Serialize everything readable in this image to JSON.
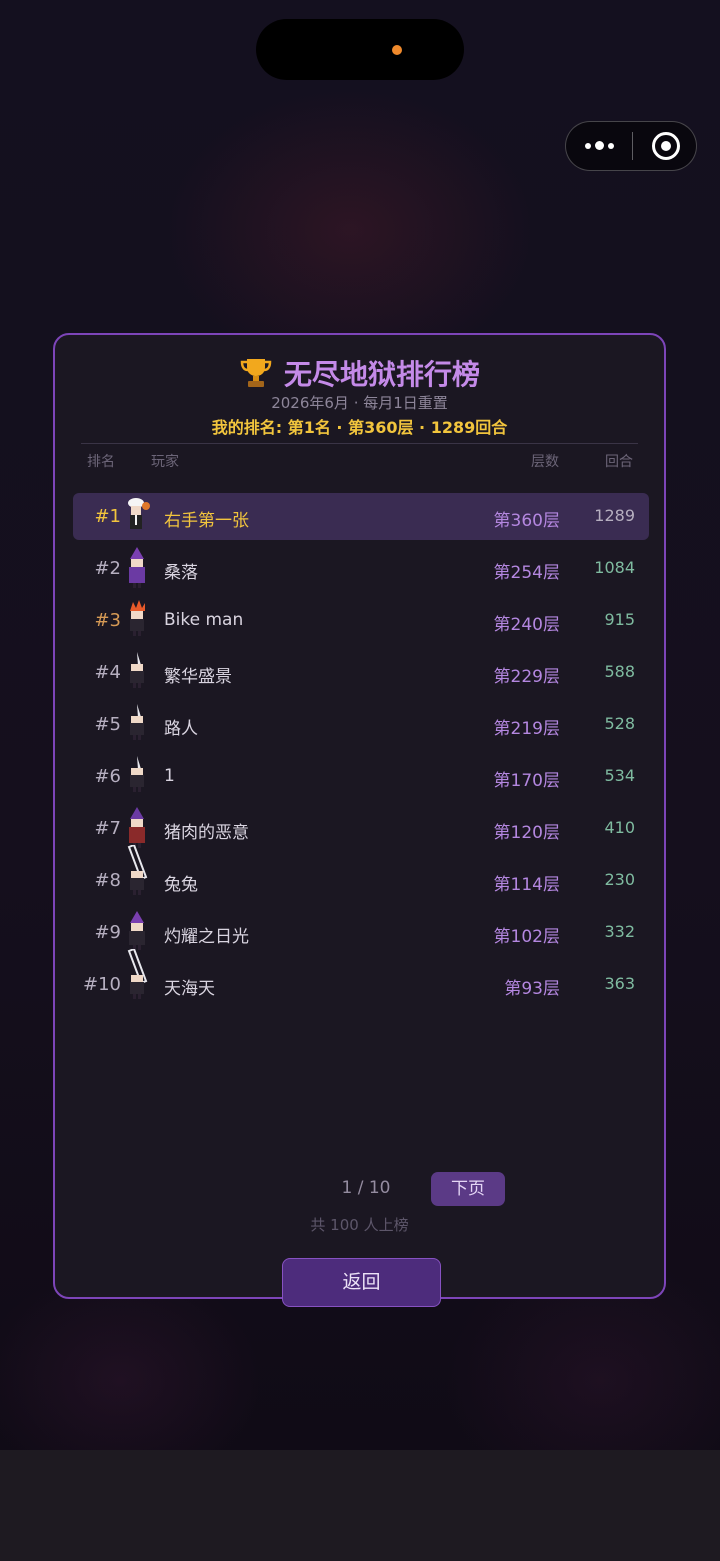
{
  "leaderboard": {
    "title": "无尽地狱排行榜",
    "subtitle": "2026年6月 · 每月1日重置",
    "my_rank": "我的排名: 第1名 · 第360层 · 1289回合",
    "headers": {
      "rank": "排名",
      "player": "玩家",
      "floor": "层数",
      "turns": "回合"
    },
    "rows": [
      {
        "rank": "#1",
        "name": "右手第一张",
        "floor": "第360层",
        "turns": "1289",
        "avatar": "chef-hat-avatar-icon"
      },
      {
        "rank": "#2",
        "name": "桑落",
        "floor": "第254层",
        "turns": "1084",
        "avatar": "purple-wizard-avatar-icon"
      },
      {
        "rank": "#3",
        "name": "Bike man",
        "floor": "第240层",
        "turns": "915",
        "avatar": "fire-hair-avatar-icon"
      },
      {
        "rank": "#4",
        "name": "繁华盛景",
        "floor": "第229层",
        "turns": "588",
        "avatar": "sword-avatar-icon"
      },
      {
        "rank": "#5",
        "name": "路人",
        "floor": "第219层",
        "turns": "528",
        "avatar": "sword-avatar-icon"
      },
      {
        "rank": "#6",
        "name": "1",
        "floor": "第170层",
        "turns": "534",
        "avatar": "sword-avatar-icon"
      },
      {
        "rank": "#7",
        "name": "猪肉的恶意",
        "floor": "第120层",
        "turns": "410",
        "avatar": "red-wizard-avatar-icon"
      },
      {
        "rank": "#8",
        "name": "兔兔",
        "floor": "第114层",
        "turns": "230",
        "avatar": "big-sword-avatar-icon"
      },
      {
        "rank": "#9",
        "name": "灼耀之日光",
        "floor": "第102层",
        "turns": "332",
        "avatar": "purple-wizard-avatar-icon"
      },
      {
        "rank": "#10",
        "name": "天海天",
        "floor": "第93层",
        "turns": "363",
        "avatar": "big-sword-avatar-icon"
      }
    ],
    "pager": {
      "label": "1 / 10",
      "next_label": "下页",
      "total": "共 100 人上榜"
    },
    "back_label": "返回"
  },
  "colors": {
    "accent_purple": "#7d45b9",
    "title_purple": "#c48ae8",
    "gold": "#f2c53d",
    "bronze": "#d69a55",
    "turns_green": "#7fbba0"
  }
}
